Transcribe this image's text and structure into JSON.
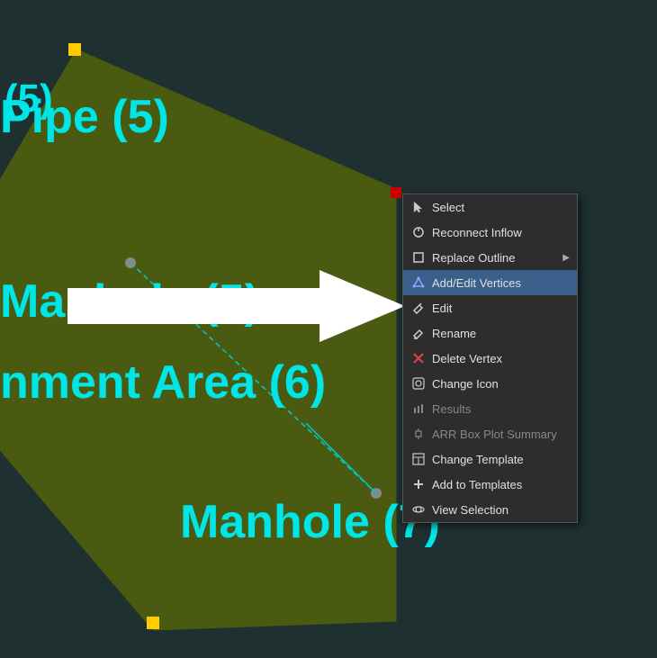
{
  "canvas": {
    "bg_color": "#1e3030",
    "labels": {
      "pipe5": "Pipe (5)",
      "paren5": "(5)",
      "manh": "Manh",
      "catchment_area": "nment Area (6)",
      "manhole7": "Manhole (7)",
      "num6": "(6)"
    }
  },
  "context_menu": {
    "items": [
      {
        "id": "select",
        "label": "Select",
        "icon": "cursor",
        "disabled": false,
        "has_arrow": false
      },
      {
        "id": "reconnect-inflow",
        "label": "Reconnect Inflow",
        "icon": "reconnect",
        "disabled": false,
        "has_arrow": false
      },
      {
        "id": "replace-outline",
        "label": "Replace Outline",
        "icon": "replace",
        "disabled": false,
        "has_arrow": true
      },
      {
        "id": "add-edit-vertices",
        "label": "Add/Edit Vertices",
        "icon": "vertices",
        "disabled": false,
        "has_arrow": false,
        "highlighted": true
      },
      {
        "id": "edit",
        "label": "Edit",
        "icon": "edit",
        "disabled": false,
        "has_arrow": false
      },
      {
        "id": "rename",
        "label": "Rename",
        "icon": "rename",
        "disabled": false,
        "has_arrow": false
      },
      {
        "id": "delete-vertex",
        "label": "Delete Vertex",
        "icon": "delete",
        "disabled": false,
        "has_arrow": false
      },
      {
        "id": "change-icon",
        "label": "Change Icon",
        "icon": "change-icon",
        "disabled": false,
        "has_arrow": false
      },
      {
        "id": "results",
        "label": "Results",
        "icon": "results",
        "disabled": true,
        "has_arrow": false
      },
      {
        "id": "arr-box-plot",
        "label": "ARR Box Plot Summary",
        "icon": "arr",
        "disabled": true,
        "has_arrow": false
      },
      {
        "id": "change-template",
        "label": "Change Template",
        "icon": "template",
        "disabled": false,
        "has_arrow": false
      },
      {
        "id": "add-to-templates",
        "label": "Add to Templates",
        "icon": "add-template",
        "disabled": false,
        "has_arrow": false
      },
      {
        "id": "view-selection",
        "label": "View Selection",
        "icon": "view",
        "disabled": false,
        "has_arrow": false
      }
    ]
  }
}
